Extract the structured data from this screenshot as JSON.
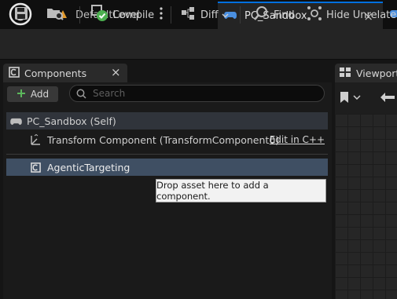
{
  "tabs": [
    {
      "label": "DefaultLevel",
      "icon": "level-icon"
    },
    {
      "label": "PC_Sandbox",
      "icon": "gamepad-icon",
      "close": "×"
    }
  ],
  "toolbar": {
    "compile": "Compile",
    "diff": "Diff",
    "find": "Find",
    "hide_unrelated": "Hide Unrelated"
  },
  "components": {
    "title": "Components",
    "close": "×",
    "add_label": "Add",
    "search_placeholder": "Search",
    "root_label": "PC_Sandbox (Self)",
    "items": [
      {
        "label": "Transform Component (TransformComponent0)",
        "action": "Edit in C++"
      },
      {
        "label": "AgenticTargeting"
      }
    ],
    "tooltip": "Drop asset here to add a component."
  },
  "viewport": {
    "title": "Viewport"
  },
  "colors": {
    "accent": "#0070e0",
    "selection": "#3f4f63",
    "add_plus": "#5cb85c"
  }
}
